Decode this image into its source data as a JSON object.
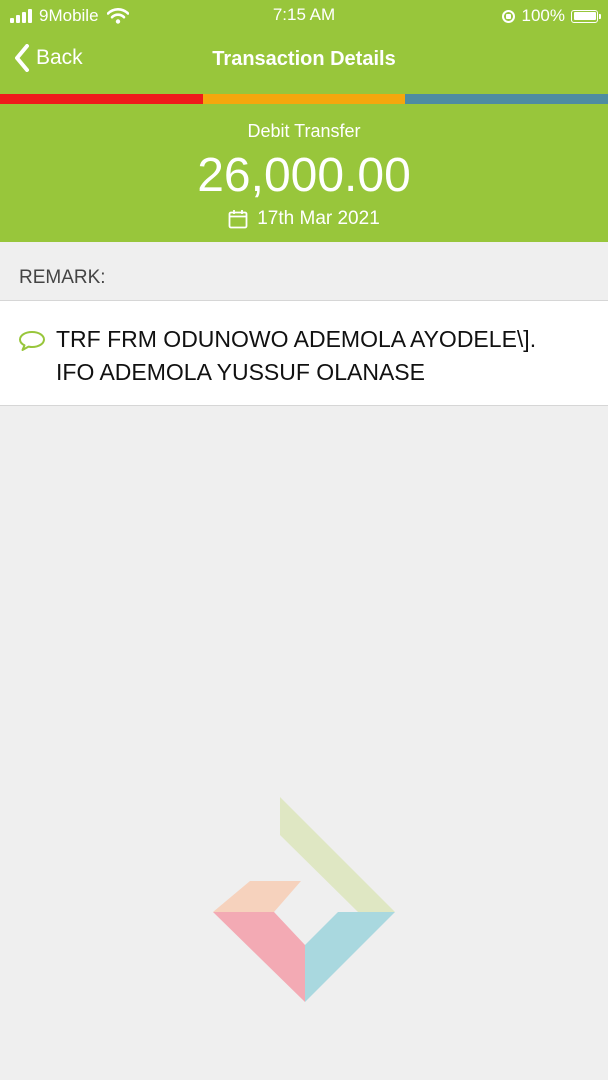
{
  "status_bar": {
    "carrier": "9Mobile",
    "time": "7:15 AM",
    "battery": "100%",
    "battery_level": 1.0,
    "icons": [
      "signal-bars-icon",
      "wifi-icon",
      "rotation-lock-icon",
      "battery-icon"
    ]
  },
  "nav": {
    "back_label": "Back",
    "title": "Transaction Details"
  },
  "stripe_colors": [
    "#ee1b1b",
    "#f5a70d",
    "#4e8ca1"
  ],
  "summary": {
    "type": "Debit Transfer",
    "amount": "26,000.00",
    "date": "17th Mar 2021"
  },
  "remark": {
    "label": "REMARK:",
    "text": "TRF FRM ODUNOWO ADEMOLA AYODELE\\].\nIFO ADEMOLA YUSSUF OLANASE"
  },
  "colors": {
    "brand_green": "#98c63b",
    "background": "#efefef",
    "logo_green": "#dfe7c3",
    "logo_peach": "#f6d2bd",
    "logo_pink": "#f3aab4",
    "logo_blue": "#a9d8df"
  }
}
